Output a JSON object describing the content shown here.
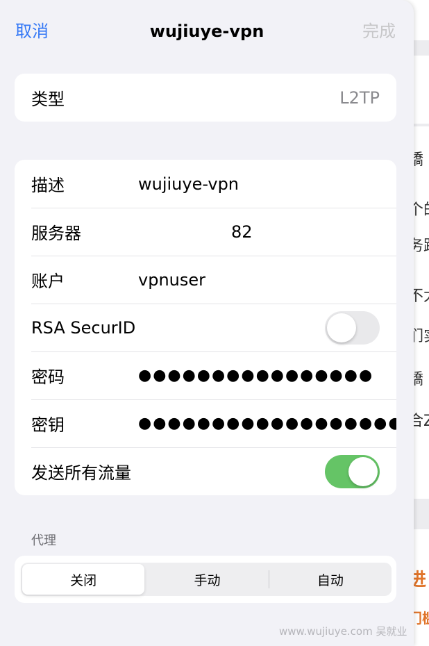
{
  "nav": {
    "cancel": "取消",
    "title": "wujiuye-vpn",
    "done": "完成"
  },
  "type_row": {
    "label": "类型",
    "value": "L2TP"
  },
  "rows": {
    "description": {
      "label": "描述",
      "value": "wujiuye-vpn"
    },
    "server": {
      "label": "服务器",
      "value": "82"
    },
    "account": {
      "label": "账户",
      "value": "vpnuser"
    },
    "rsa": {
      "label": "RSA SecurID",
      "on": false
    },
    "password": {
      "label": "密码",
      "value": "●●●●●●●●●●●●●●●●"
    },
    "secret": {
      "label": "密钥",
      "value": "●●●●●●●●●●●●●●●●●●●●"
    },
    "send_all": {
      "label": "发送所有流量",
      "on": true
    }
  },
  "proxy": {
    "header": "代理",
    "options": [
      "关闭",
      "手动",
      "自动"
    ],
    "selected": "关闭"
  },
  "background_page": {
    "fragments": [
      "嬌",
      "个的",
      "务跟",
      "不太",
      "们实",
      "嬌",
      "合Z",
      "进",
      "门槛"
    ]
  },
  "watermark": "www.wujiuye.com 吴就业",
  "colors": {
    "accent": "#3478f6",
    "toggle_on": "#65c466",
    "toggle_off": "#e9e9eb",
    "background": "#f2f2f7"
  }
}
